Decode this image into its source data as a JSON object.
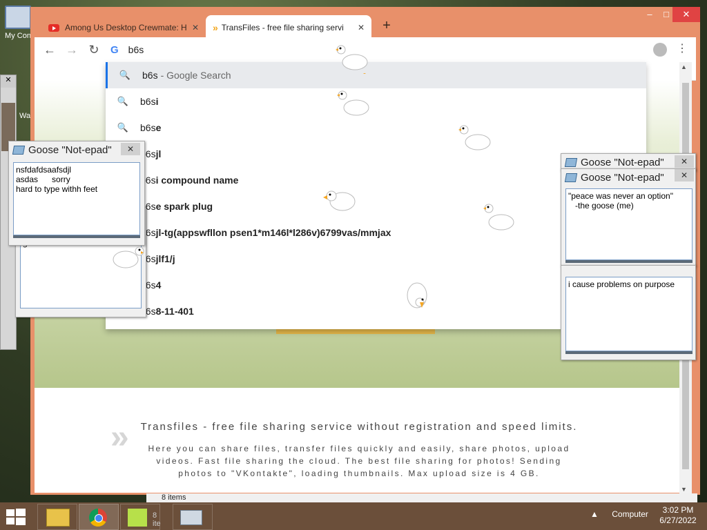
{
  "desktop": {
    "icon_label": "My Con",
    "icon_label2": "Wa"
  },
  "browser": {
    "tabs": [
      {
        "title": "Among Us Desktop Crewmate: H",
        "icon": "youtube-icon"
      },
      {
        "title": "TransFiles - free file sharing servi",
        "icon": "transfiles-icon"
      }
    ],
    "new_tab": "+",
    "window_controls": {
      "minimize": "–",
      "maximize": "□",
      "close": "✕"
    },
    "omnibox_text": "b6s",
    "nav": {
      "back": "←",
      "forward": "→",
      "reload": "↻",
      "menu": "⋮"
    }
  },
  "suggestions": [
    {
      "typed": "b6s",
      "bold": "",
      "suffix": " - Google Search"
    },
    {
      "typed": "b6s",
      "bold": "i",
      "suffix": ""
    },
    {
      "typed": "b6s",
      "bold": "e",
      "suffix": ""
    },
    {
      "typed": "b6s",
      "bold": "jl",
      "suffix": ""
    },
    {
      "typed": "b6s",
      "bold": "i compound name",
      "suffix": ""
    },
    {
      "typed": "b6s",
      "bold": "e spark plug",
      "suffix": ""
    },
    {
      "typed": "b6s",
      "bold": "jl-tg(appswfllon psen1*m146l*l286v)6799vas/mmjax",
      "suffix": ""
    },
    {
      "typed": "b6s",
      "bold": "jlf1/j",
      "suffix": ""
    },
    {
      "typed": "b6s",
      "bold": "4",
      "suffix": ""
    },
    {
      "typed": "b6s",
      "bold": "8-11-401",
      "suffix": ""
    }
  ],
  "page": {
    "footer_title": "Transfiles - free file sharing service without registration and speed limits.",
    "footer_text": "Here you can share files, transfer files quickly and easily, share photos, upload videos. Fast file sharing the cloud. The best file sharing for photos! Sending photos to \"VKontakte\", loading thumbnails. Max upload size is 4 GB."
  },
  "notepads": [
    {
      "title": "Goose \"Not-epad\"",
      "text": "nsfdafdsaafsdjl\nasdas      sorry\nhard to type withh feet"
    },
    {
      "title": "Goose \"Not-epad\"",
      "text": ""
    },
    {
      "title": "Goose \"Not-epad\"",
      "text": "\"peace was never an option\"\n   -the goose (me)"
    },
    {
      "title": "Goose \"Not-epad\"",
      "text": "i cause problems on purpose"
    }
  ],
  "behind_note_text": "good work",
  "file_explorer": {
    "status": "8 items",
    "status2": "8 ite"
  },
  "taskbar": {
    "time": "3:02 PM",
    "date": "6/27/2022",
    "tray_label": "Computer"
  },
  "colors": {
    "chrome_frame": "#e8906a",
    "taskbar": "#6b4f3a",
    "accent": "#1a73e8",
    "goose_beak": "#f5a623"
  }
}
